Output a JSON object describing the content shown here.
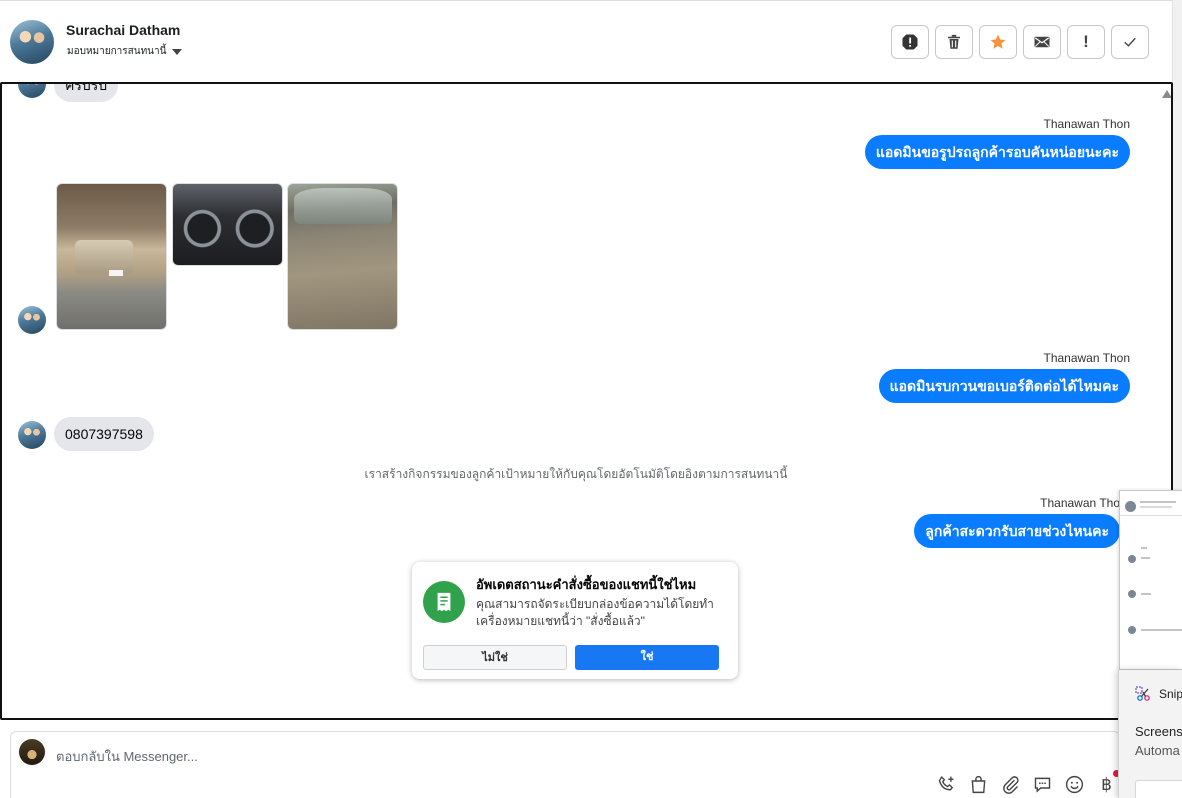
{
  "header": {
    "contact_name": "Surachai Datham",
    "assign_label": "มอบหมายการสนทนานี้"
  },
  "actions": [
    {
      "name": "spam-icon"
    },
    {
      "name": "trash-icon"
    },
    {
      "name": "star-icon"
    },
    {
      "name": "mail-icon"
    },
    {
      "name": "important-icon",
      "label": "!"
    },
    {
      "name": "check-icon"
    }
  ],
  "messages": {
    "top_partial": "ครับรับ",
    "out1": {
      "sender": "Thanawan Thon",
      "text": "แอดมินขอรูปรถลูกค้ารอบคันหน่อยนะคะ"
    },
    "out2": {
      "sender": "Thanawan Thon",
      "text": "แอดมินรบกวนขอเบอร์ติดต่อได้ไหมคะ"
    },
    "in_phone": "0807397598",
    "system": "เราสร้างกิจกรรมของลูกค้าเป้าหมายให้กับคุณโดยอัตโนมัติโดยอิงตามการสนทนานี้",
    "out3": {
      "sender": "Thanawan Tho",
      "text": "ลูกค้าสะดวกรับสายช่วงไหนคะ"
    }
  },
  "popup": {
    "title": "อัพเดตสถานะคำสั่งซื้อของแชทนี้ใช่ไหม",
    "desc_line1": "คุณสามารถจัดระเบียบกล่องข้อความได้โดยทำ",
    "desc_line2": "เครื่องหมายแชทนี้ว่า \"สั่งซื้อแล้ว\"",
    "no_label": "ไม่ใช่",
    "yes_label": "ใช่"
  },
  "composer": {
    "placeholder": "ตอบกลับใน Messenger..."
  },
  "tools": {
    "baht_symbol": "฿"
  },
  "toast": {
    "app_name": "Snip",
    "line1": "Screens",
    "line2": "Automa"
  },
  "colors": {
    "outgoing_bubble": "#0a7cff",
    "incoming_bubble": "#e4e6eb",
    "star": "#f7923a",
    "popup_icon": "#31a24c",
    "yes_button": "#1877f2"
  }
}
